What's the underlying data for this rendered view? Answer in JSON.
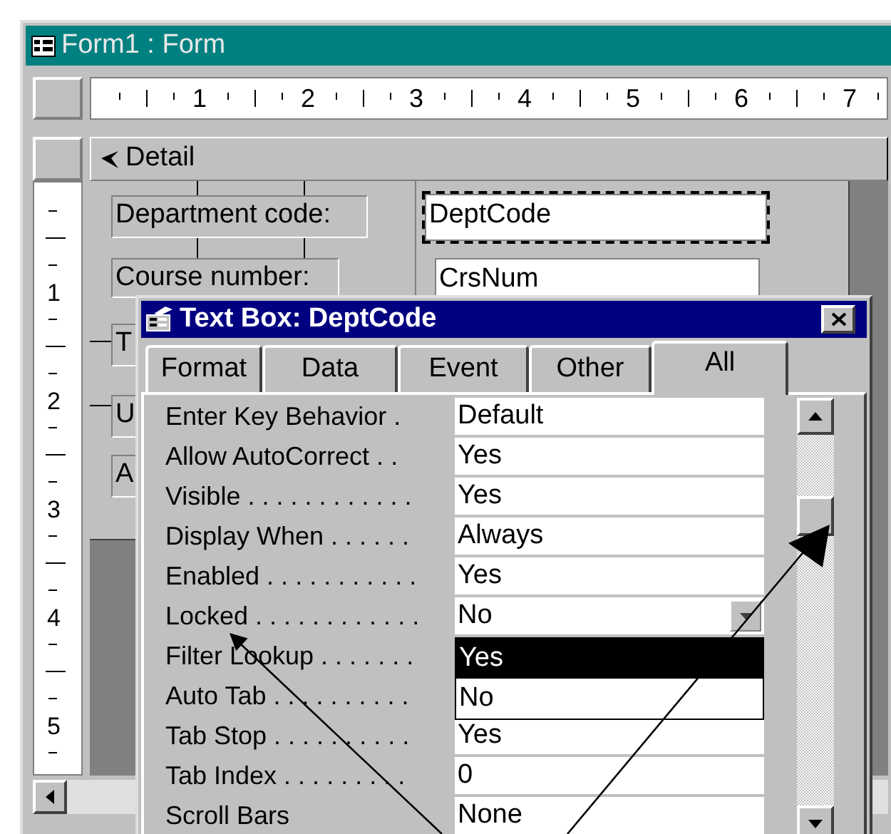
{
  "form_window": {
    "title": "Form1 : Form"
  },
  "horizontal_ruler": {
    "labels": [
      "1",
      "2",
      "3",
      "4",
      "5",
      "6",
      "7"
    ]
  },
  "vertical_ruler": {
    "labels": [
      "1",
      "2",
      "3",
      "4",
      "5"
    ]
  },
  "section": {
    "title": "Detail"
  },
  "controls": [
    {
      "kind": "label",
      "text": "Department code:",
      "selected": false
    },
    {
      "kind": "textbox",
      "text": "DeptCode",
      "selected": true
    },
    {
      "kind": "label",
      "text": "Course number:",
      "selected": false
    },
    {
      "kind": "textbox",
      "text": "CrsNum",
      "selected": false
    },
    {
      "kind": "label",
      "text": "T",
      "selected": false
    },
    {
      "kind": "label",
      "text": "U",
      "selected": false
    },
    {
      "kind": "label",
      "text": "A",
      "selected": false
    }
  ],
  "property_sheet": {
    "title": "Text Box: DeptCode",
    "tabs": [
      {
        "label": "Format",
        "selected": false
      },
      {
        "label": "Data",
        "selected": false
      },
      {
        "label": "Event",
        "selected": false
      },
      {
        "label": "Other",
        "selected": false
      },
      {
        "label": "All",
        "selected": true
      }
    ],
    "properties": [
      {
        "label": "Enter Key Behavior .",
        "value": "Default",
        "kind": "text"
      },
      {
        "label": "Allow AutoCorrect . .",
        "value": "Yes",
        "kind": "text"
      },
      {
        "label": "Visible . . . . . . . . . . . .",
        "value": "Yes",
        "kind": "text"
      },
      {
        "label": "Display When . . . . . .",
        "value": "Always",
        "kind": "text"
      },
      {
        "label": "Enabled . . . . . . . . . . .",
        "value": "Yes",
        "kind": "text"
      },
      {
        "label": "Locked . . . . . . . . . . . .",
        "value": "No",
        "kind": "combo"
      },
      {
        "label": "Filter Lookup . . . . . . ."
      },
      {
        "label": "Auto Tab . . . . . . . . . ."
      },
      {
        "label": "Tab Stop . . . . . . . . . .",
        "value": "Yes",
        "kind": "text"
      },
      {
        "label": "Tab Index . . . . . . . . .",
        "value": "0",
        "kind": "text"
      },
      {
        "label": "Scroll Bars",
        "value": "None",
        "kind": "text"
      }
    ],
    "dropdown_options": [
      {
        "label": "Yes",
        "selected": true
      },
      {
        "label": "No",
        "selected": false
      }
    ]
  }
}
